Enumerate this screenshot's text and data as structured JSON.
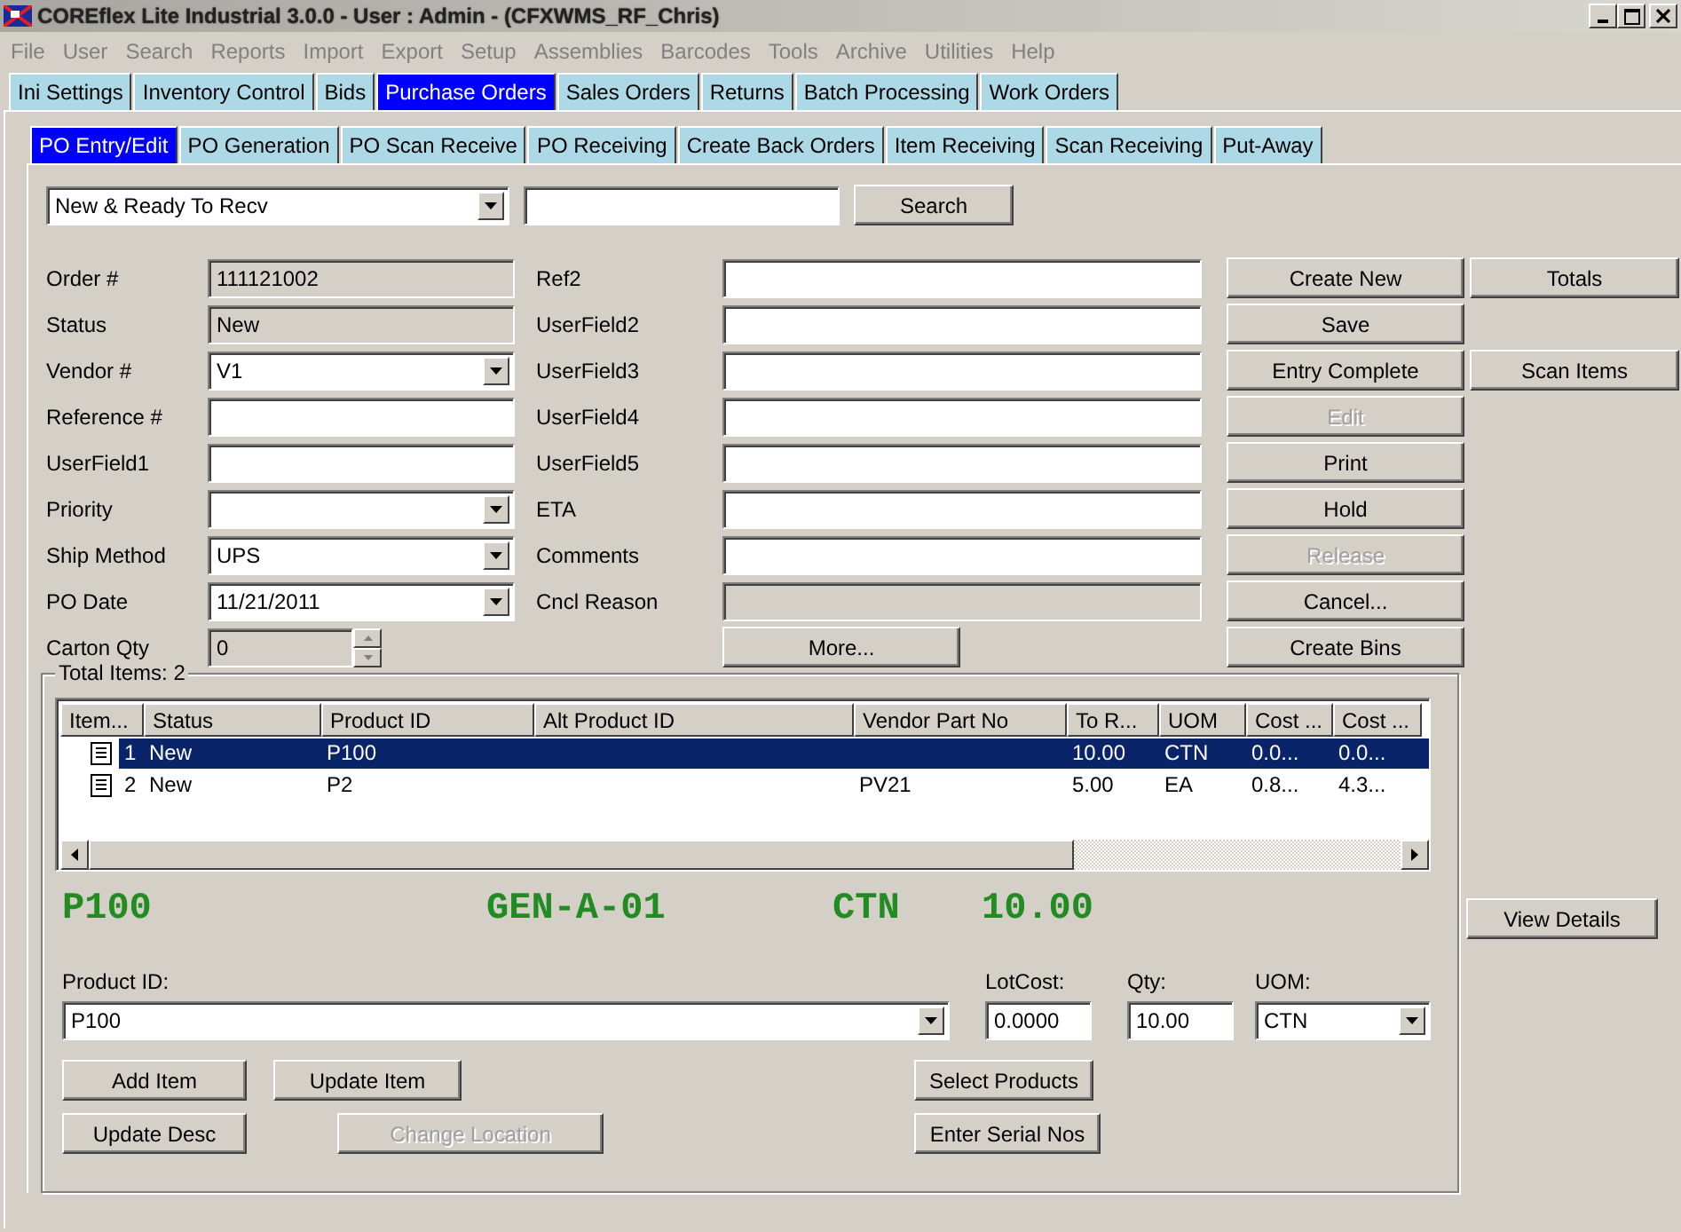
{
  "window": {
    "title": "COREflex Lite Industrial 3.0.0 - User : Admin - (CFXWMS_RF_Chris)"
  },
  "menu": [
    "File",
    "User",
    "Search",
    "Reports",
    "Import",
    "Export",
    "Setup",
    "Assemblies",
    "Barcodes",
    "Tools",
    "Archive",
    "Utilities",
    "Help"
  ],
  "tabs": [
    {
      "label": "Ini Settings",
      "selected": false
    },
    {
      "label": "Inventory Control",
      "selected": false
    },
    {
      "label": "Bids",
      "selected": false
    },
    {
      "label": "Purchase Orders",
      "selected": true
    },
    {
      "label": "Sales Orders",
      "selected": false
    },
    {
      "label": "Returns",
      "selected": false
    },
    {
      "label": "Batch Processing",
      "selected": false
    },
    {
      "label": "Work Orders",
      "selected": false
    }
  ],
  "subtabs": [
    {
      "label": "PO Entry/Edit",
      "selected": true
    },
    {
      "label": "PO Generation",
      "selected": false
    },
    {
      "label": "PO Scan Receive",
      "selected": false
    },
    {
      "label": "PO Receiving",
      "selected": false
    },
    {
      "label": "Create Back Orders",
      "selected": false
    },
    {
      "label": "Item Receiving",
      "selected": false
    },
    {
      "label": "Scan Receiving",
      "selected": false
    },
    {
      "label": "Put-Away",
      "selected": false
    }
  ],
  "filter": {
    "value": "New & Ready To Recv",
    "search_button": "Search"
  },
  "form_left": [
    {
      "label": "Order #",
      "kind": "readonly",
      "value": "111121002"
    },
    {
      "label": "Status",
      "kind": "readonly",
      "value": "New"
    },
    {
      "label": "Vendor #",
      "kind": "combo",
      "value": "V1"
    },
    {
      "label": "Reference #",
      "kind": "text"
    },
    {
      "label": "UserField1",
      "kind": "text"
    },
    {
      "label": "Priority",
      "kind": "combo"
    },
    {
      "label": "Ship Method",
      "kind": "combo",
      "value": "UPS"
    },
    {
      "label": "PO Date",
      "kind": "combo",
      "value": "11/21/2011"
    },
    {
      "label": "Carton Qty",
      "kind": "spin",
      "value": "0"
    }
  ],
  "form_right": [
    {
      "label": "Ref2",
      "kind": "text"
    },
    {
      "label": "UserField2",
      "kind": "text"
    },
    {
      "label": "UserField3",
      "kind": "text"
    },
    {
      "label": "UserField4",
      "kind": "text"
    },
    {
      "label": "UserField5",
      "kind": "text"
    },
    {
      "label": "ETA",
      "kind": "text"
    },
    {
      "label": "Comments",
      "kind": "text"
    },
    {
      "label": "Cncl Reason",
      "kind": "readonly"
    },
    {
      "kind": "button",
      "value": "More..."
    }
  ],
  "actions": [
    {
      "label": "Create New",
      "disabled": false,
      "side": {
        "label": "Totals",
        "disabled": false
      }
    },
    {
      "label": "Save",
      "disabled": false
    },
    {
      "label": "Entry Complete",
      "disabled": false,
      "side": {
        "label": "Scan Items",
        "disabled": false
      }
    },
    {
      "label": "Edit",
      "disabled": true
    },
    {
      "label": "Print",
      "disabled": false
    },
    {
      "label": "Hold",
      "disabled": false
    },
    {
      "label": "Release",
      "disabled": true
    },
    {
      "label": "Cancel...",
      "disabled": false
    },
    {
      "label": "Create Bins",
      "disabled": false
    }
  ],
  "items": {
    "title": "Total Items: 2",
    "columns": [
      "Item...",
      "Status",
      "Product ID",
      "Alt Product ID",
      "Vendor Part No",
      "To R...",
      "UOM",
      "Cost ...",
      "Cost ..."
    ],
    "rows": [
      {
        "selected": true,
        "cells": [
          "1",
          "New",
          "P100",
          "",
          "",
          "10.00",
          "CTN",
          "0.0...",
          "0.0..."
        ]
      },
      {
        "selected": false,
        "cells": [
          "2",
          "New",
          "P2",
          "",
          "PV21",
          "5.00",
          "EA",
          "0.8...",
          "4.3..."
        ]
      }
    ]
  },
  "current": {
    "product": "P100",
    "location": "GEN-A-01",
    "uom": "CTN",
    "qty": "10.00"
  },
  "entry": {
    "product_label": "Product ID:",
    "product": "P100",
    "lot_cost_label": "LotCost:",
    "lot_cost": "0.0000",
    "qty_label": "Qty:",
    "qty": "10.00",
    "uom_label": "UOM:",
    "uom": "CTN"
  },
  "entry_buttons": [
    {
      "label": "Add Item",
      "disabled": false
    },
    {
      "label": "Update Item",
      "disabled": false
    },
    {
      "label": "Select Products",
      "disabled": false
    },
    {
      "label": "Update Desc",
      "disabled": false
    },
    {
      "label": "Change Location",
      "disabled": true
    },
    {
      "label": "Enter Serial Nos",
      "disabled": false
    }
  ],
  "view_details": "View Details"
}
